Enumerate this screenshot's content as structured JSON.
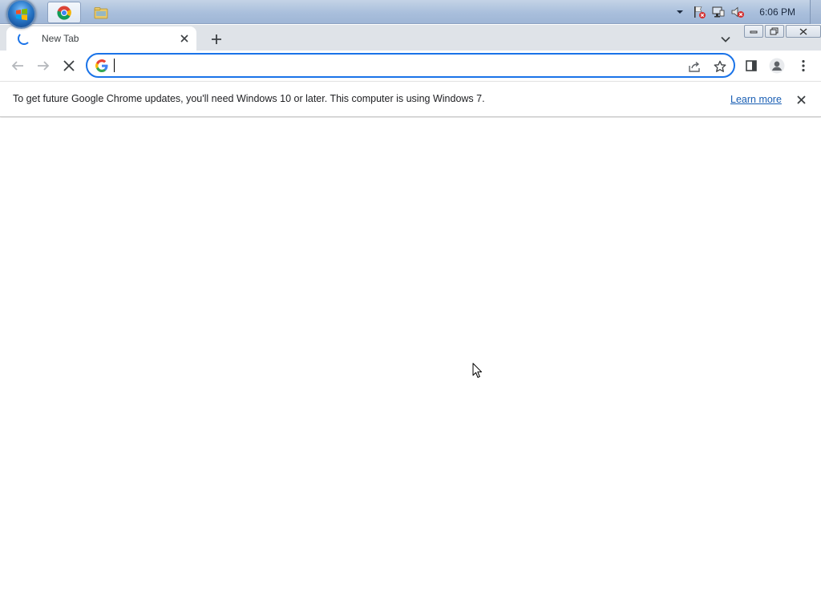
{
  "taskbar": {
    "start_button_label": "Start",
    "apps": [
      {
        "name": "Google Chrome",
        "icon": "chrome-icon",
        "active": true
      },
      {
        "name": "Windows Explorer",
        "icon": "folder-icon",
        "active": false
      }
    ],
    "tray": {
      "icons": [
        "show-hidden-icons-arrow",
        "action-center-flag-icon",
        "network-icon",
        "volume-muted-icon"
      ],
      "clock": "6:06 PM"
    }
  },
  "browser": {
    "tab": {
      "title": "New Tab",
      "loading": true
    },
    "new_tab_label": "+",
    "omnibox": {
      "value": "",
      "placeholder": ""
    },
    "infobar": {
      "message": "To get future Google Chrome updates, you'll need Windows 10 or later. This computer is using Windows 7.",
      "link": "Learn more"
    }
  },
  "colors": {
    "accent": "#1a73e8",
    "tabstrip_bg": "#dfe3e8",
    "link": "#1a5fb4"
  }
}
